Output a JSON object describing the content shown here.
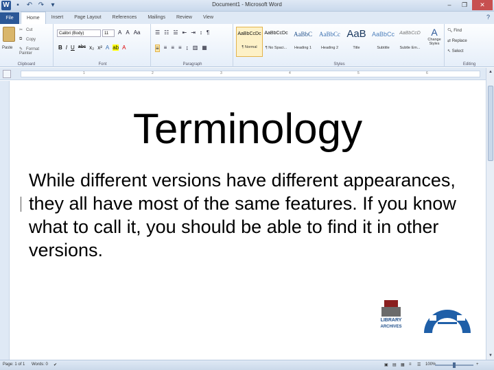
{
  "window": {
    "title": "Document1 - Microsoft Word",
    "controls": [
      "–",
      "❐",
      "✕"
    ]
  },
  "ribbon_tabs": [
    "File",
    "Home",
    "Insert",
    "Page Layout",
    "References",
    "Mailings",
    "Review",
    "View"
  ],
  "clipboard": {
    "paste": "Paste",
    "cut": "Cut",
    "copy": "Copy",
    "format_painter": "Format Painter",
    "label": "Clipboard"
  },
  "font": {
    "name": "Calibri (Body)",
    "size": "11",
    "label": "Font",
    "format_buttons": [
      "B",
      "I",
      "U",
      "abc",
      "x₂",
      "x²"
    ]
  },
  "paragraph": {
    "label": "Paragraph"
  },
  "styles": {
    "label": "Styles",
    "tiles": [
      {
        "sample": "AaBbCcDc",
        "name": "¶ Normal"
      },
      {
        "sample": "AaBbCcDc",
        "name": "¶ No Spaci..."
      },
      {
        "sample": "AaBbC",
        "name": "Heading 1"
      },
      {
        "sample": "AaBbCc",
        "name": "Heading 2"
      },
      {
        "sample": "AaB",
        "name": "Title"
      },
      {
        "sample": "AaBbCc",
        "name": "Subtitle"
      },
      {
        "sample": "AaBbCcD",
        "name": "Subtle Em..."
      }
    ],
    "change_styles": "Change Styles"
  },
  "editing": {
    "label": "Editing",
    "find": "Find",
    "replace": "Replace",
    "select": "Select"
  },
  "document": {
    "title": "Terminology",
    "body": "While different versions have different appearances, they all have most of the same features. If you know what to call it, you should be able to find it in other versions.",
    "logo_text_1": "LIBRARY",
    "logo_text_2": "ARCHIVES"
  },
  "status": {
    "page": "Page: 1 of 1",
    "words": "Words: 0",
    "zoom": "100%"
  },
  "colors": {
    "accent": "#2b5797",
    "ribbon_bg": "#e5eef9"
  }
}
